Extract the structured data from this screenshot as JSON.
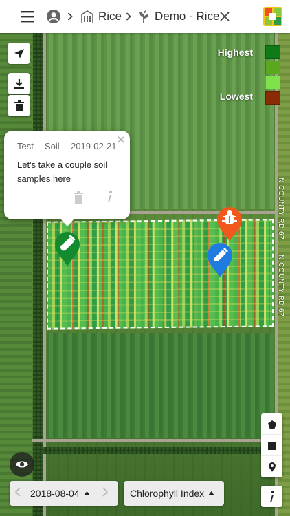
{
  "header": {
    "breadcrumb": [
      {
        "label": "Rice",
        "icon": "building-icon"
      },
      {
        "label": "Demo - Rice",
        "icon": "sprout-icon"
      }
    ]
  },
  "legend": {
    "highest_label": "Highest",
    "lowest_label": "Lowest",
    "colors": [
      "#0f7a18",
      "#5aa81e",
      "#7fe24a",
      "#8a2b06"
    ]
  },
  "popup": {
    "author": "Test",
    "category": "Soil",
    "date": "2019-02-21",
    "note": "Let's take a couple soil samples here"
  },
  "road_labels": [
    "N COUNTY RD 67",
    "N COUNTY RD 67"
  ],
  "bottom": {
    "date": "2018-08-04",
    "layer": "Chlorophyll Index"
  },
  "pins": {
    "soil_sample": "#138a2e",
    "pest": "#f0581c",
    "note": "#1f7be0"
  }
}
